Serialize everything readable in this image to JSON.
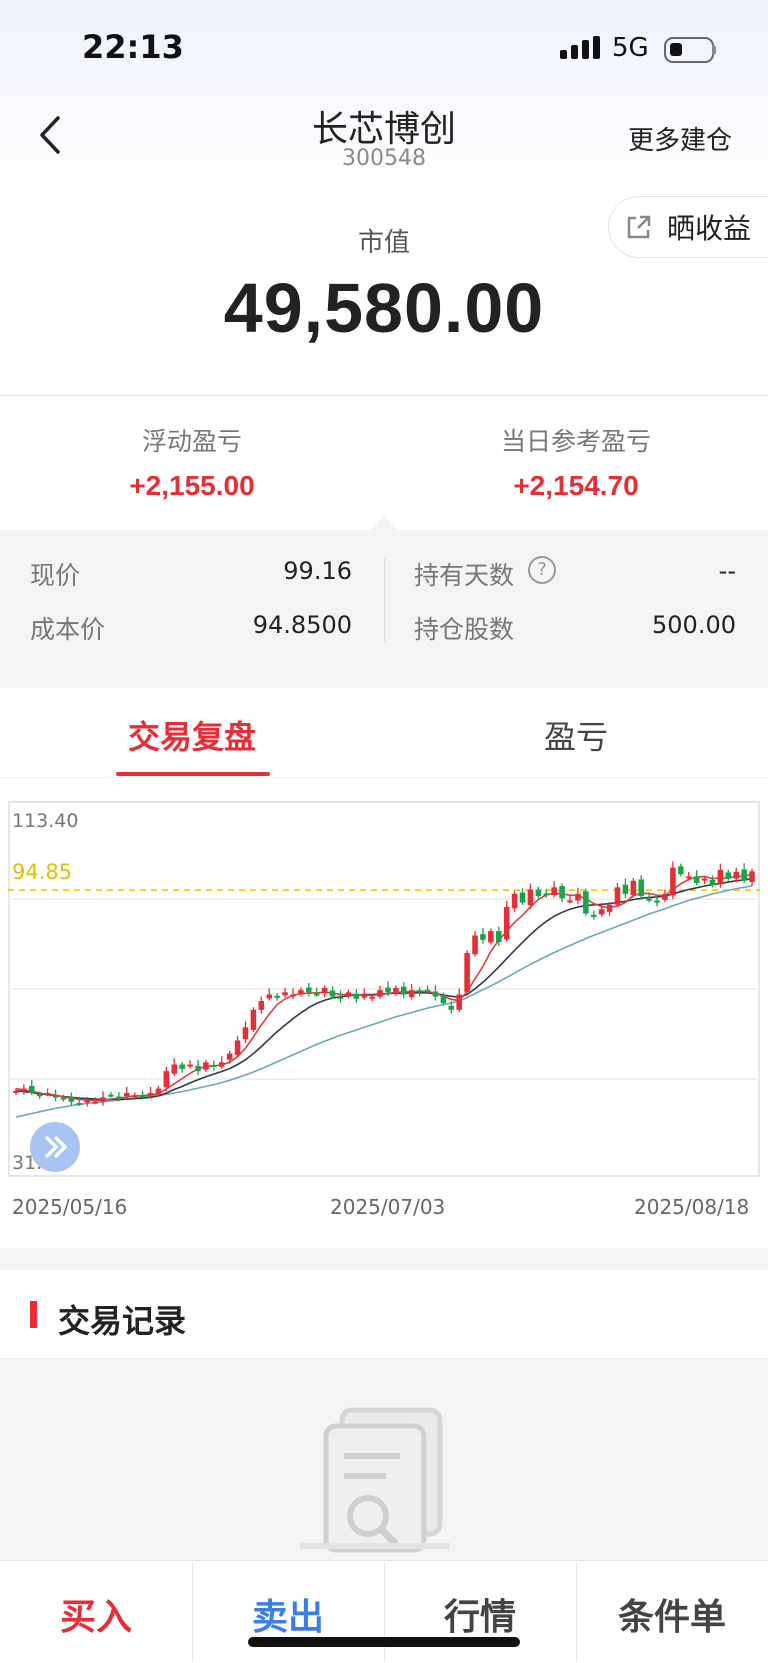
{
  "status_bar": {
    "time": "22:13",
    "network": "5G"
  },
  "header": {
    "stock_name": "长芯博创",
    "stock_code": "300548",
    "more_label": "更多建仓"
  },
  "share": {
    "label": "晒收益"
  },
  "market_value": {
    "label": "市值",
    "value": "49,580.00"
  },
  "pl": {
    "floating_label": "浮动盈亏",
    "floating_value": "+2,155.00",
    "daily_label": "当日参考盈亏",
    "daily_value": "+2,154.70"
  },
  "details": {
    "price_label": "现价",
    "price_value": "99.16",
    "cost_label": "成本价",
    "cost_value": "94.8500",
    "days_label": "持有天数",
    "days_value": "--",
    "help_glyph": "?",
    "shares_label": "持仓股数",
    "shares_value": "500.00"
  },
  "tabs": [
    {
      "label": "交易复盘",
      "active": true
    },
    {
      "label": "盈亏",
      "active": false
    }
  ],
  "chart_data": {
    "type": "candlestick",
    "y_max_label": "113.40",
    "y_min_label": "31.12",
    "ylim": [
      31.12,
      113.4
    ],
    "reference_line": {
      "value": 94.85,
      "label": "94.85",
      "color": "#e6c200"
    },
    "x_labels": [
      "2025/05/16",
      "2025/07/03",
      "2025/08/18"
    ],
    "up_color": "#e62e37",
    "down_color": "#1aa34a",
    "closes": [
      49,
      49.5,
      48.5,
      48,
      48.5,
      47.5,
      47,
      46.5,
      46,
      47,
      46.5,
      47.5,
      48,
      47.5,
      48.5,
      48,
      47.5,
      48.5,
      49.5,
      53.5,
      55,
      54,
      55,
      53.5,
      55.5,
      54.5,
      55.5,
      57.5,
      60.5,
      63.5,
      67.5,
      69.5,
      71,
      70.5,
      71.5,
      71,
      72,
      71.5,
      71,
      72.5,
      70.5,
      70,
      71.5,
      70,
      71,
      70.5,
      72,
      71.5,
      72.5,
      71,
      72,
      71.5,
      72,
      70.5,
      69,
      67.5,
      71,
      80.5,
      84.5,
      83.5,
      85.5,
      83,
      91,
      94,
      92,
      95,
      93.5,
      94,
      95.5,
      93,
      92.5,
      94,
      89.5,
      89,
      90.5,
      91.5,
      95.5,
      94,
      97,
      93.5,
      92.5,
      92,
      94,
      100,
      98.5,
      98,
      96.5,
      97.5,
      96,
      99.5,
      97.5,
      99,
      97,
      99.16
    ],
    "ma_short": [
      49.5,
      49.2,
      48.9,
      48.5,
      48.2,
      48.0,
      47.6,
      47.3,
      47.0,
      46.9,
      46.8,
      46.9,
      47.1,
      47.3,
      47.6,
      47.8,
      47.9,
      48.0,
      48.3,
      49.4,
      50.6,
      51.8,
      53.0,
      54.0,
      54.6,
      54.7,
      54.9,
      55.5,
      56.8,
      58.7,
      61.3,
      64.0,
      66.5,
      68.7,
      70.0,
      70.8,
      71.2,
      71.3,
      71.4,
      71.5,
      71.3,
      71.0,
      71.0,
      70.9,
      70.9,
      70.8,
      71.0,
      71.2,
      71.5,
      71.6,
      71.7,
      71.7,
      71.7,
      71.3,
      70.6,
      69.9,
      69.6,
      71.7,
      74.6,
      77.4,
      80.9,
      83.4,
      85.5,
      87.5,
      89.1,
      91.0,
      92.7,
      93.8,
      94.1,
      94.0,
      93.7,
      93.6,
      92.9,
      91.8,
      91.1,
      90.9,
      91.2,
      92.0,
      93.6,
      94.1,
      94.1,
      93.7,
      93.6,
      95.0,
      96.3,
      97.3,
      97.8,
      98.0,
      97.5,
      97.6,
      97.6,
      98.0,
      98.0,
      98.5
    ],
    "ma_mid": [
      49.0,
      48.8,
      48.6,
      48.3,
      48.1,
      47.9,
      47.7,
      47.5,
      47.3,
      47.2,
      47.1,
      47.0,
      47.0,
      47.0,
      47.1,
      47.2,
      47.3,
      47.5,
      47.8,
      48.5,
      49.3,
      50.0,
      50.8,
      51.5,
      52.2,
      52.8,
      53.4,
      54.1,
      55.0,
      56.1,
      57.5,
      59.1,
      60.8,
      62.5,
      64.0,
      65.5,
      66.8,
      68.0,
      69.0,
      69.7,
      70.2,
      70.5,
      70.7,
      70.9,
      71.0,
      71.0,
      71.1,
      71.2,
      71.3,
      71.3,
      71.4,
      71.4,
      71.4,
      71.2,
      70.9,
      70.6,
      70.4,
      71.0,
      72.3,
      73.8,
      75.5,
      77.3,
      79.2,
      81.1,
      82.9,
      84.7,
      86.3,
      87.7,
      88.9,
      89.8,
      90.5,
      91.0,
      91.3,
      91.5,
      91.6,
      91.8,
      92.0,
      92.3,
      92.7,
      93.0,
      93.2,
      93.3,
      93.5,
      94.0,
      94.5,
      95.0,
      95.4,
      95.8,
      96.1,
      96.4,
      96.7,
      97.0,
      97.2,
      97.5
    ],
    "ma_long": [
      43.0,
      43.4,
      43.8,
      44.2,
      44.6,
      45.0,
      45.3,
      45.6,
      45.9,
      46.1,
      46.3,
      46.5,
      46.7,
      46.9,
      47.1,
      47.3,
      47.5,
      47.7,
      47.9,
      48.2,
      48.5,
      48.8,
      49.2,
      49.6,
      50.0,
      50.4,
      50.9,
      51.4,
      52.0,
      52.6,
      53.3,
      54.0,
      54.8,
      55.6,
      56.4,
      57.2,
      58.0,
      58.8,
      59.6,
      60.3,
      61.0,
      61.7,
      62.3,
      62.9,
      63.5,
      64.1,
      64.7,
      65.3,
      65.9,
      66.4,
      66.9,
      67.4,
      67.9,
      68.3,
      68.7,
      69.1,
      69.5,
      70.3,
      71.2,
      72.1,
      73.0,
      73.9,
      74.9,
      75.9,
      76.9,
      77.9,
      78.8,
      79.7,
      80.6,
      81.4,
      82.2,
      83.0,
      83.8,
      84.5,
      85.2,
      85.9,
      86.6,
      87.3,
      88.0,
      88.7,
      89.4,
      90.0,
      90.6,
      91.3,
      91.9,
      92.5,
      93.0,
      93.5,
      94.0,
      94.4,
      94.8,
      95.2,
      95.5,
      95.8
    ],
    "ma_colors": [
      "#e03c3c",
      "#2f3b4a",
      "#6aaab0"
    ]
  },
  "records": {
    "title": "交易记录"
  },
  "bottom_bar": {
    "buy": "买入",
    "sell": "卖出",
    "market": "行情",
    "conditional": "条件单"
  }
}
